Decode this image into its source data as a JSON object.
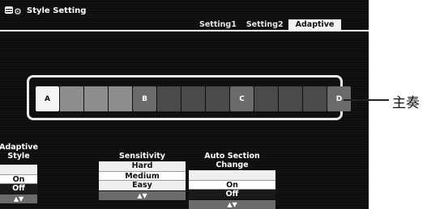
{
  "header": {
    "title": "Style Setting",
    "tabs": [
      {
        "label": "Setting1",
        "active": false
      },
      {
        "label": "Setting2",
        "active": false
      },
      {
        "label": "Adaptive",
        "active": true
      }
    ]
  },
  "sections": {
    "a": "A",
    "b": "B",
    "c": "C",
    "d": "D",
    "active": "A"
  },
  "adaptive_style": {
    "label_line1": "Adaptive",
    "label_line2": "Style",
    "options": [
      "",
      "On",
      "Off"
    ],
    "selected": "On",
    "arrows": "▲▼"
  },
  "sensitivity": {
    "label": "Sensitivity",
    "options": [
      "Hard",
      "Medium",
      "Easy"
    ],
    "selected": "Medium",
    "arrows": "▲▼"
  },
  "auto_section_change": {
    "label": "Auto Section Change",
    "options": [
      "",
      "On",
      "Off"
    ],
    "selected": "On",
    "arrows": "▲▼"
  },
  "annotation": {
    "text": "主奏"
  }
}
